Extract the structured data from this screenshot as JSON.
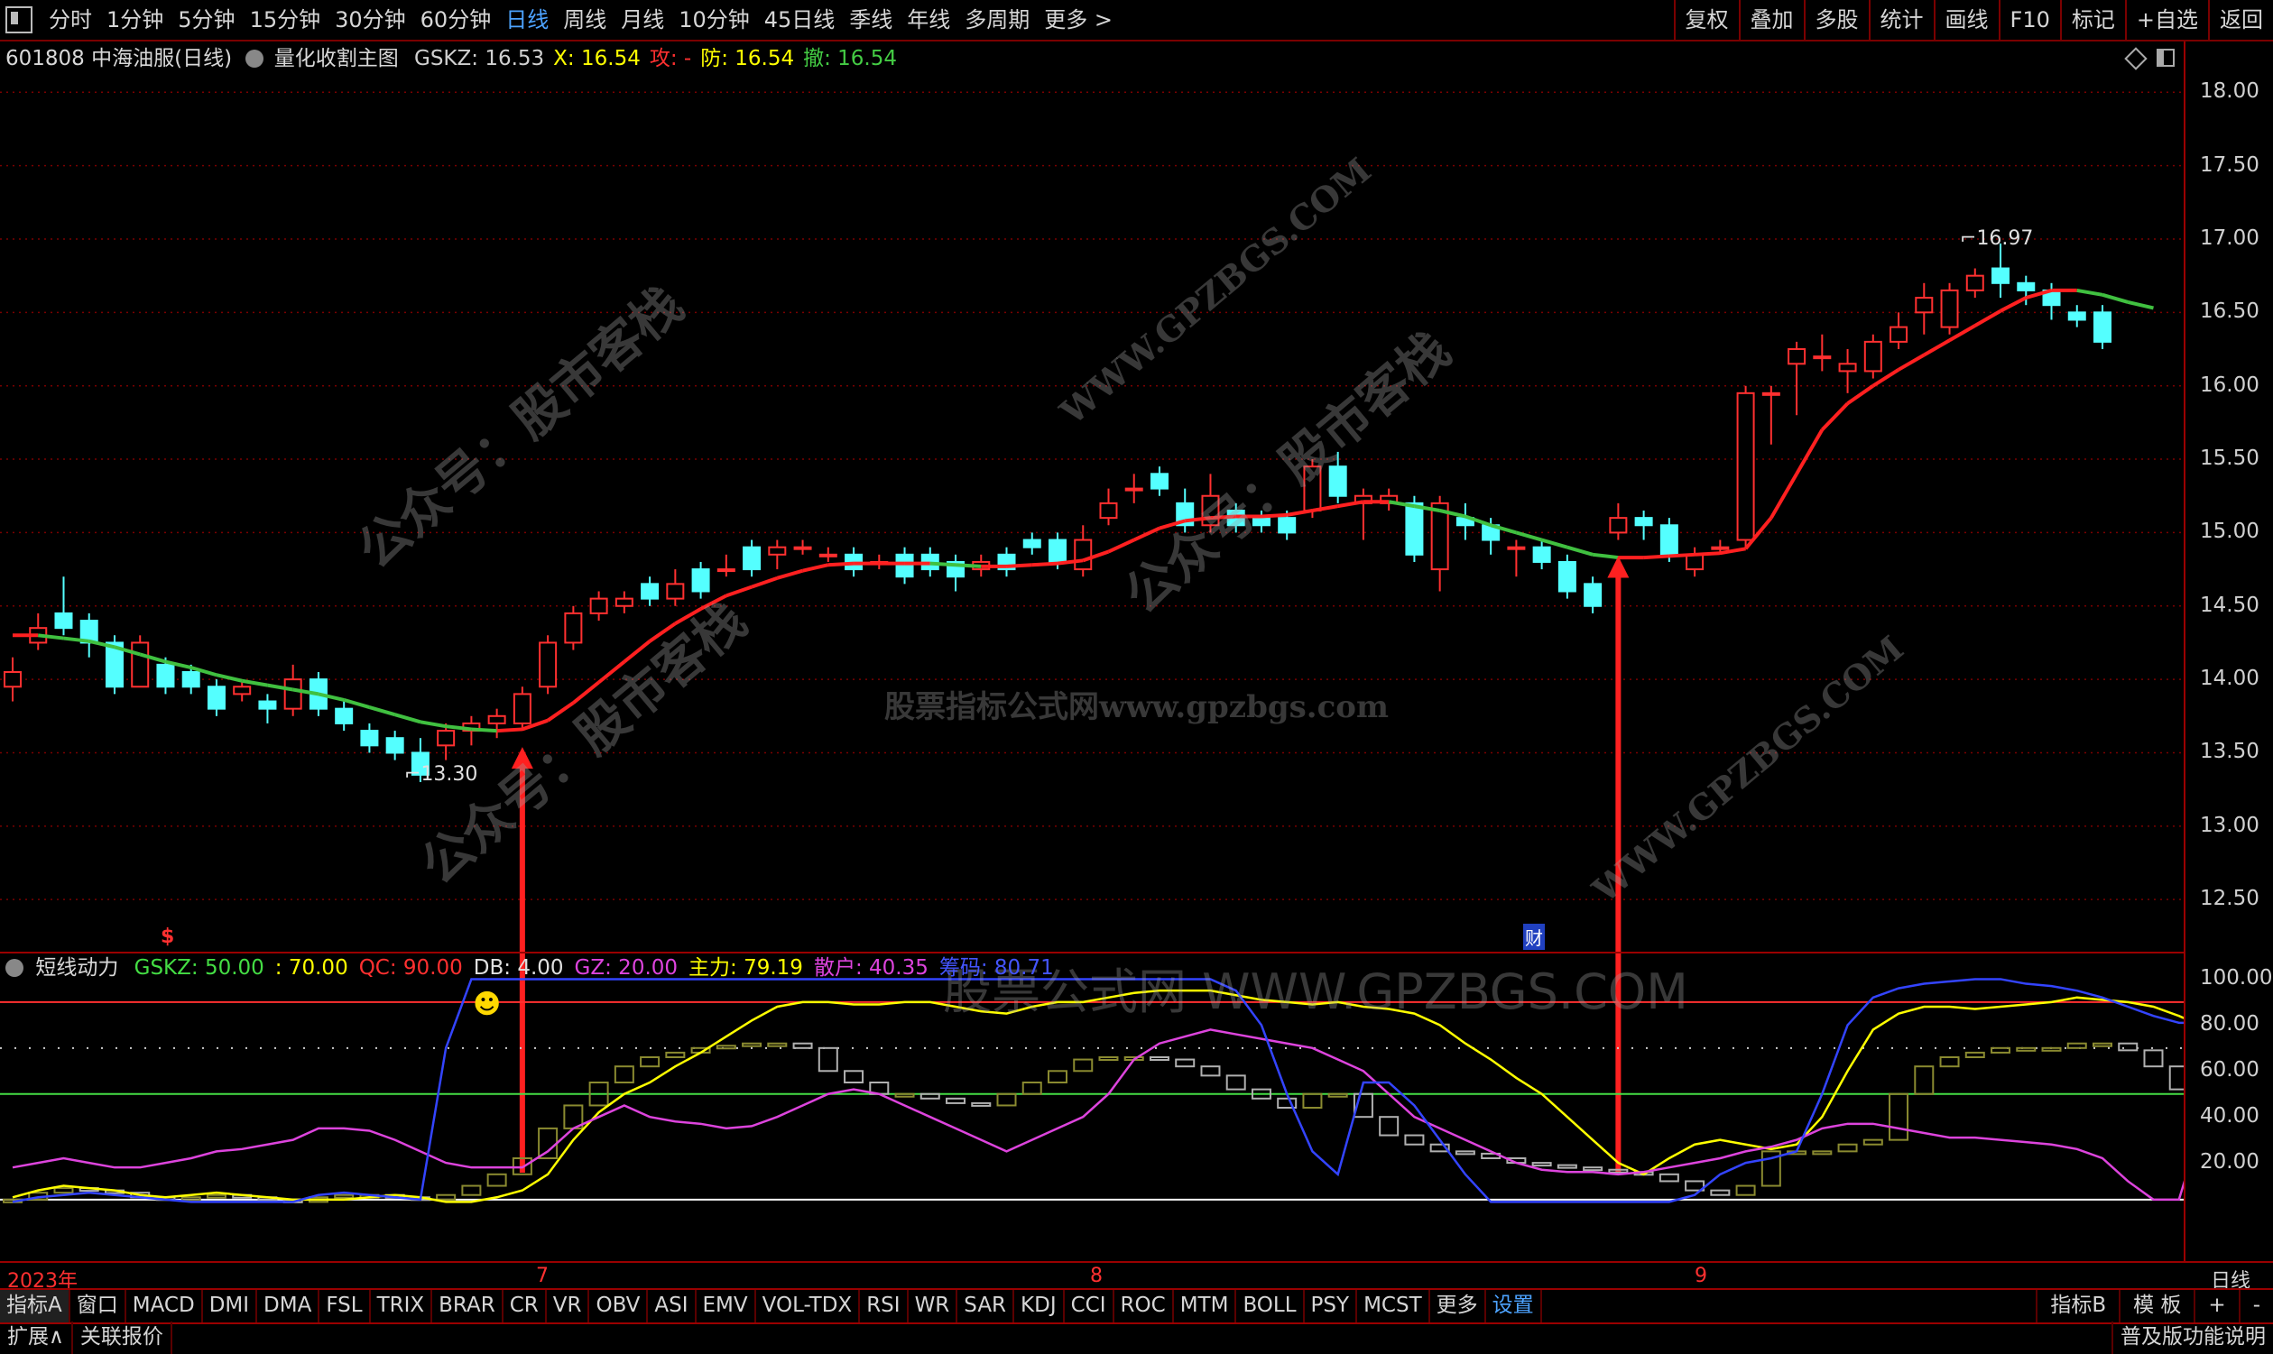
{
  "toolbar": {
    "periods": [
      "分时",
      "1分钟",
      "5分钟",
      "15分钟",
      "30分钟",
      "60分钟",
      "日线",
      "周线",
      "月线",
      "10分钟",
      "45日线",
      "季线",
      "年线",
      "多周期",
      "更多 >"
    ],
    "active_period": "日线",
    "right_buttons": [
      "复权",
      "叠加",
      "多股",
      "统计",
      "画线",
      "F10",
      "标记",
      "+自选",
      "返回"
    ]
  },
  "stock": {
    "code_name": "601808 中海油服(日线)",
    "formula": "量化收割主图",
    "fields": [
      {
        "label": "GSKZ: 16.53",
        "color": "#d0d0d0"
      },
      {
        "label": "X: 16.54",
        "color": "#ffff00"
      },
      {
        "label": "攻: -",
        "color": "#ff3030"
      },
      {
        "label": "防: 16.54",
        "color": "#ffff00"
      },
      {
        "label": "撤: 16.54",
        "color": "#44cc44"
      }
    ]
  },
  "price_axis": [
    "18.00",
    "17.50",
    "17.00",
    "16.50",
    "16.00",
    "15.50",
    "15.00",
    "14.50",
    "14.00",
    "13.50",
    "13.00",
    "12.50"
  ],
  "annotations": {
    "high": "16.97",
    "low": "13.30",
    "smiley": "☻",
    "dollar": "$",
    "cai": "财"
  },
  "indicator": {
    "name": "短线动力",
    "fields": [
      {
        "label": "GSKZ: 50.00",
        "color": "#44dd44"
      },
      {
        "label": ": 70.00",
        "color": "#ffff00"
      },
      {
        "label": "QC: 90.00",
        "color": "#ff3030"
      },
      {
        "label": "DB: 4.00",
        "color": "#e0e0e0"
      },
      {
        "label": "GZ: 20.00",
        "color": "#dd44dd"
      },
      {
        "label": "主力: 79.19",
        "color": "#ffff00"
      },
      {
        "label": "散户: 40.35",
        "color": "#dd44dd"
      },
      {
        "label": "筹码: 80.71",
        "color": "#4455ff"
      }
    ],
    "axis": [
      "100.00",
      "80.00",
      "60.00",
      "40.00",
      "20.00"
    ]
  },
  "dates": {
    "year": "2023年",
    "months": [
      "7",
      "8",
      "9"
    ],
    "right_label": "日线"
  },
  "indicator_tabs": [
    "指标A",
    "窗口",
    "MACD",
    "DMI",
    "DMA",
    "FSL",
    "TRIX",
    "BRAR",
    "CR",
    "VR",
    "OBV",
    "ASI",
    "EMV",
    "VOL-TDX",
    "RSI",
    "WR",
    "SAR",
    "KDJ",
    "CCI",
    "ROC",
    "MTM",
    "BOLL",
    "PSY",
    "MCST",
    "更多",
    "设置"
  ],
  "active_tab": "设置",
  "indicator_tabs_right": [
    "指标B",
    "模 板",
    "+",
    "-"
  ],
  "bottom": {
    "left": [
      "扩展∧",
      "关联报价"
    ],
    "right": "普及版功能说明"
  },
  "watermarks": [
    "公众号：股市客栈",
    "WWW.GPZBGS.COM",
    "股票指标公式网www.gpzbgs.com",
    "股票公式网 WWW.GPZBGS.COM"
  ],
  "chart_data": [
    {
      "type": "candlestick",
      "title": "量化收割主图",
      "ylim": [
        12.2,
        18.1
      ],
      "x_labels": [
        "7",
        "8",
        "9"
      ],
      "candles": [
        {
          "o": 13.95,
          "c": 14.05,
          "h": 14.15,
          "l": 13.85
        },
        {
          "o": 14.25,
          "c": 14.35,
          "h": 14.45,
          "l": 14.2
        },
        {
          "o": 14.45,
          "c": 14.35,
          "h": 14.7,
          "l": 14.3
        },
        {
          "o": 14.4,
          "c": 14.25,
          "h": 14.45,
          "l": 14.15
        },
        {
          "o": 14.25,
          "c": 13.95,
          "h": 14.3,
          "l": 13.9
        },
        {
          "o": 13.95,
          "c": 14.25,
          "h": 14.3,
          "l": 13.95
        },
        {
          "o": 14.1,
          "c": 13.95,
          "h": 14.15,
          "l": 13.9
        },
        {
          "o": 14.05,
          "c": 13.95,
          "h": 14.1,
          "l": 13.9
        },
        {
          "o": 13.95,
          "c": 13.8,
          "h": 14.0,
          "l": 13.75
        },
        {
          "o": 13.9,
          "c": 13.95,
          "h": 13.98,
          "l": 13.85
        },
        {
          "o": 13.85,
          "c": 13.8,
          "h": 13.9,
          "l": 13.7
        },
        {
          "o": 13.8,
          "c": 14.0,
          "h": 14.1,
          "l": 13.75
        },
        {
          "o": 14.0,
          "c": 13.8,
          "h": 14.05,
          "l": 13.75
        },
        {
          "o": 13.8,
          "c": 13.7,
          "h": 13.85,
          "l": 13.65
        },
        {
          "o": 13.65,
          "c": 13.55,
          "h": 13.7,
          "l": 13.5
        },
        {
          "o": 13.6,
          "c": 13.5,
          "h": 13.65,
          "l": 13.45
        },
        {
          "o": 13.5,
          "c": 13.35,
          "h": 13.6,
          "l": 13.3
        },
        {
          "o": 13.55,
          "c": 13.65,
          "h": 13.7,
          "l": 13.45
        },
        {
          "o": 13.65,
          "c": 13.7,
          "h": 13.75,
          "l": 13.55
        },
        {
          "o": 13.7,
          "c": 13.75,
          "h": 13.8,
          "l": 13.6
        },
        {
          "o": 13.7,
          "c": 13.9,
          "h": 13.95,
          "l": 13.65
        },
        {
          "o": 13.95,
          "c": 14.25,
          "h": 14.3,
          "l": 13.9
        },
        {
          "o": 14.25,
          "c": 14.45,
          "h": 14.5,
          "l": 14.2
        },
        {
          "o": 14.45,
          "c": 14.55,
          "h": 14.6,
          "l": 14.4
        },
        {
          "o": 14.5,
          "c": 14.55,
          "h": 14.6,
          "l": 14.45
        },
        {
          "o": 14.65,
          "c": 14.55,
          "h": 14.7,
          "l": 14.5
        },
        {
          "o": 14.55,
          "c": 14.65,
          "h": 14.75,
          "l": 14.5
        },
        {
          "o": 14.75,
          "c": 14.6,
          "h": 14.8,
          "l": 14.55
        },
        {
          "o": 14.75,
          "c": 14.75,
          "h": 14.85,
          "l": 14.7
        },
        {
          "o": 14.9,
          "c": 14.75,
          "h": 14.95,
          "l": 14.7
        },
        {
          "o": 14.85,
          "c": 14.9,
          "h": 14.95,
          "l": 14.75
        },
        {
          "o": 14.9,
          "c": 14.9,
          "h": 14.95,
          "l": 14.85
        },
        {
          "o": 14.85,
          "c": 14.85,
          "h": 14.9,
          "l": 14.8
        },
        {
          "o": 14.85,
          "c": 14.75,
          "h": 14.9,
          "l": 14.7
        },
        {
          "o": 14.8,
          "c": 14.8,
          "h": 14.85,
          "l": 14.75
        },
        {
          "o": 14.85,
          "c": 14.7,
          "h": 14.9,
          "l": 14.65
        },
        {
          "o": 14.85,
          "c": 14.75,
          "h": 14.9,
          "l": 14.7
        },
        {
          "o": 14.8,
          "c": 14.7,
          "h": 14.85,
          "l": 14.6
        },
        {
          "o": 14.75,
          "c": 14.8,
          "h": 14.85,
          "l": 14.7
        },
        {
          "o": 14.85,
          "c": 14.75,
          "h": 14.9,
          "l": 14.7
        },
        {
          "o": 14.95,
          "c": 14.9,
          "h": 15.0,
          "l": 14.85
        },
        {
          "o": 14.95,
          "c": 14.8,
          "h": 15.0,
          "l": 14.75
        },
        {
          "o": 14.75,
          "c": 14.95,
          "h": 15.05,
          "l": 14.7
        },
        {
          "o": 15.1,
          "c": 15.2,
          "h": 15.3,
          "l": 15.05
        },
        {
          "o": 15.3,
          "c": 15.3,
          "h": 15.4,
          "l": 15.2
        },
        {
          "o": 15.4,
          "c": 15.3,
          "h": 15.45,
          "l": 15.25
        },
        {
          "o": 15.2,
          "c": 15.05,
          "h": 15.3,
          "l": 15.0
        },
        {
          "o": 15.05,
          "c": 15.25,
          "h": 15.4,
          "l": 15.0
        },
        {
          "o": 15.15,
          "c": 15.05,
          "h": 15.2,
          "l": 15.0
        },
        {
          "o": 15.1,
          "c": 15.05,
          "h": 15.15,
          "l": 15.0
        },
        {
          "o": 15.1,
          "c": 15.0,
          "h": 15.15,
          "l": 14.95
        },
        {
          "o": 15.15,
          "c": 15.45,
          "h": 15.5,
          "l": 15.1
        },
        {
          "o": 15.45,
          "c": 15.25,
          "h": 15.55,
          "l": 15.2
        },
        {
          "o": 15.2,
          "c": 15.25,
          "h": 15.3,
          "l": 14.95
        },
        {
          "o": 15.2,
          "c": 15.25,
          "h": 15.3,
          "l": 15.15
        },
        {
          "o": 15.2,
          "c": 14.85,
          "h": 15.25,
          "l": 14.8
        },
        {
          "o": 14.75,
          "c": 15.2,
          "h": 15.25,
          "l": 14.6
        },
        {
          "o": 15.1,
          "c": 15.05,
          "h": 15.2,
          "l": 14.95
        },
        {
          "o": 15.05,
          "c": 14.95,
          "h": 15.1,
          "l": 14.85
        },
        {
          "o": 14.9,
          "c": 14.9,
          "h": 14.95,
          "l": 14.7
        },
        {
          "o": 14.9,
          "c": 14.8,
          "h": 14.95,
          "l": 14.75
        },
        {
          "o": 14.8,
          "c": 14.6,
          "h": 14.85,
          "l": 14.55
        },
        {
          "o": 14.65,
          "c": 14.5,
          "h": 14.7,
          "l": 14.45
        },
        {
          "o": 15.0,
          "c": 15.1,
          "h": 15.2,
          "l": 14.95
        },
        {
          "o": 15.1,
          "c": 15.05,
          "h": 15.15,
          "l": 14.95
        },
        {
          "o": 15.05,
          "c": 14.85,
          "h": 15.1,
          "l": 14.8
        },
        {
          "o": 14.75,
          "c": 14.85,
          "h": 14.9,
          "l": 14.7
        },
        {
          "o": 14.9,
          "c": 14.9,
          "h": 14.95,
          "l": 14.85
        },
        {
          "o": 14.95,
          "c": 15.95,
          "h": 16.0,
          "l": 14.9
        },
        {
          "o": 15.95,
          "c": 15.95,
          "h": 16.0,
          "l": 15.6
        },
        {
          "o": 16.15,
          "c": 16.25,
          "h": 16.3,
          "l": 15.8
        },
        {
          "o": 16.2,
          "c": 16.2,
          "h": 16.35,
          "l": 16.1
        },
        {
          "o": 16.1,
          "c": 16.15,
          "h": 16.25,
          "l": 15.95
        },
        {
          "o": 16.1,
          "c": 16.3,
          "h": 16.35,
          "l": 16.05
        },
        {
          "o": 16.3,
          "c": 16.4,
          "h": 16.5,
          "l": 16.25
        },
        {
          "o": 16.5,
          "c": 16.6,
          "h": 16.7,
          "l": 16.35
        },
        {
          "o": 16.4,
          "c": 16.65,
          "h": 16.7,
          "l": 16.35
        },
        {
          "o": 16.65,
          "c": 16.75,
          "h": 16.8,
          "l": 16.6
        },
        {
          "o": 16.8,
          "c": 16.7,
          "h": 16.97,
          "l": 16.6
        },
        {
          "o": 16.7,
          "c": 16.65,
          "h": 16.75,
          "l": 16.55
        },
        {
          "o": 16.65,
          "c": 16.55,
          "h": 16.7,
          "l": 16.45
        },
        {
          "o": 16.5,
          "c": 16.45,
          "h": 16.55,
          "l": 16.4
        },
        {
          "o": 16.5,
          "c": 16.3,
          "h": 16.55,
          "l": 16.25
        }
      ],
      "ma_line": [
        14.3,
        14.3,
        14.28,
        14.26,
        14.22,
        14.17,
        14.12,
        14.08,
        14.03,
        13.99,
        13.96,
        13.93,
        13.9,
        13.86,
        13.81,
        13.76,
        13.71,
        13.68,
        13.66,
        13.65,
        13.66,
        13.72,
        13.84,
        13.98,
        14.12,
        14.26,
        14.38,
        14.48,
        14.57,
        14.63,
        14.69,
        14.74,
        14.78,
        14.79,
        14.79,
        14.79,
        14.79,
        14.78,
        14.77,
        14.77,
        14.78,
        14.79,
        14.81,
        14.87,
        14.95,
        15.03,
        15.08,
        15.1,
        15.11,
        15.11,
        15.12,
        15.15,
        15.18,
        15.21,
        15.21,
        15.18,
        15.15,
        15.11,
        15.05,
        15.0,
        14.95,
        14.9,
        14.85,
        14.83,
        14.83,
        14.84,
        14.85,
        14.86,
        14.89,
        15.1,
        15.4,
        15.7,
        15.88,
        16.0,
        16.11,
        16.21,
        16.31,
        16.41,
        16.51,
        16.6,
        16.65,
        16.65,
        16.62,
        16.57,
        16.53
      ],
      "ma_colors": [
        "r",
        "g"
      ],
      "signals": [
        {
          "index": 20,
          "type": "buy"
        },
        {
          "index": 63,
          "type": "buy"
        }
      ]
    },
    {
      "type": "line",
      "title": "短线动力",
      "ylim": [
        0,
        110
      ],
      "levels": [
        {
          "name": "QC",
          "value": 90,
          "color": "#ff3030",
          "style": "solid"
        },
        {
          "name": "",
          "value": 70,
          "color": "#cccccc",
          "style": "dotted"
        },
        {
          "name": "GSKZ",
          "value": 50,
          "color": "#44dd44",
          "style": "solid"
        },
        {
          "name": "",
          "value": 4,
          "color": "#ffffff",
          "style": "solid"
        }
      ],
      "series": [
        {
          "name": "主力",
          "color": "#ffff00",
          "values": [
            5,
            8,
            10,
            9,
            8,
            6,
            5,
            6,
            7,
            6,
            5,
            4,
            4,
            4,
            5,
            6,
            5,
            3,
            3,
            5,
            8,
            15,
            30,
            42,
            50,
            55,
            62,
            68,
            75,
            82,
            88,
            90,
            90,
            89,
            89,
            90,
            90,
            88,
            86,
            85,
            88,
            90,
            90,
            92,
            94,
            95,
            95,
            95,
            93,
            91,
            90,
            89,
            90,
            88,
            87,
            85,
            80,
            72,
            65,
            57,
            50,
            40,
            30,
            20,
            15,
            22,
            28,
            30,
            28,
            26,
            28,
            40,
            60,
            78,
            85,
            88,
            88,
            87,
            88,
            89,
            90,
            92,
            91,
            90,
            88,
            84,
            79
          ]
        },
        {
          "name": "散户",
          "color": "#dd44dd",
          "values": [
            18,
            20,
            22,
            20,
            18,
            18,
            20,
            22,
            25,
            26,
            28,
            30,
            35,
            35,
            34,
            30,
            25,
            20,
            18,
            18,
            18,
            25,
            35,
            40,
            45,
            40,
            38,
            37,
            35,
            36,
            40,
            45,
            50,
            52,
            50,
            45,
            40,
            35,
            30,
            25,
            30,
            35,
            40,
            50,
            65,
            72,
            75,
            78,
            76,
            74,
            72,
            70,
            65,
            60,
            50,
            40,
            35,
            30,
            25,
            20,
            17,
            16,
            16,
            15,
            16,
            18,
            20,
            22,
            25,
            27,
            30,
            35,
            37,
            37,
            35,
            33,
            31,
            31,
            30,
            29,
            28,
            26,
            22,
            12,
            4,
            4,
            40
          ]
        },
        {
          "name": "筹码",
          "color": "#3344ff",
          "values": [
            3,
            5,
            6,
            7,
            6,
            5,
            4,
            3,
            3,
            3,
            3,
            3,
            6,
            7,
            6,
            5,
            4,
            70,
            100,
            100,
            100,
            100,
            100,
            100,
            100,
            100,
            100,
            100,
            100,
            100,
            100,
            100,
            100,
            100,
            100,
            100,
            100,
            100,
            100,
            100,
            100,
            100,
            100,
            100,
            100,
            100,
            100,
            100,
            95,
            80,
            50,
            25,
            15,
            55,
            55,
            45,
            30,
            15,
            3,
            3,
            3,
            3,
            3,
            3,
            3,
            3,
            6,
            15,
            20,
            22,
            25,
            50,
            80,
            92,
            96,
            98,
            99,
            100,
            100,
            98,
            97,
            95,
            92,
            88,
            84,
            81,
            81
          ]
        },
        {
          "name": "GZ",
          "color": "#cccccc",
          "values": [
            4,
            7,
            9,
            8,
            7,
            5,
            4,
            5,
            6,
            5,
            4,
            3,
            5,
            6,
            6,
            5,
            4,
            6,
            10,
            15,
            22,
            35,
            45,
            55,
            62,
            66,
            68,
            70,
            71,
            72,
            72,
            70,
            60,
            55,
            50,
            50,
            48,
            46,
            45,
            50,
            55,
            60,
            65,
            66,
            66,
            65,
            62,
            58,
            52,
            48,
            44,
            50,
            50,
            40,
            32,
            28,
            25,
            24,
            22,
            20,
            19,
            18,
            17,
            16,
            15,
            12,
            8,
            6,
            10,
            25,
            25,
            25,
            28,
            30,
            50,
            62,
            66,
            68,
            70,
            70,
            70,
            72,
            72,
            69,
            62,
            52,
            40
          ]
        }
      ]
    }
  ]
}
